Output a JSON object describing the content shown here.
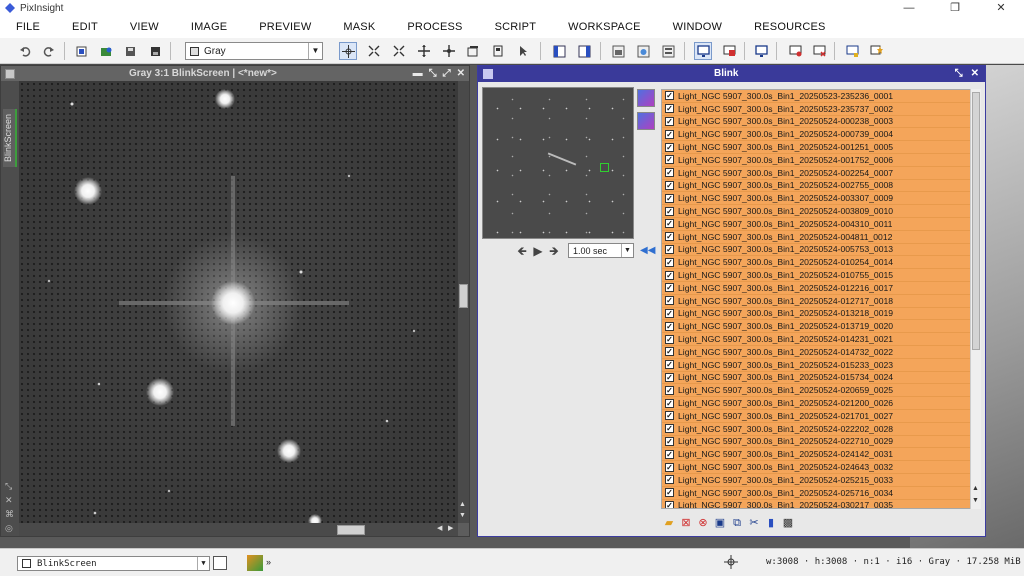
{
  "app": {
    "title": "PixInsight",
    "window_controls": [
      "—",
      "❐",
      "✕"
    ]
  },
  "menu": [
    "FILE",
    "EDIT",
    "VIEW",
    "IMAGE",
    "PREVIEW",
    "MASK",
    "PROCESS",
    "SCRIPT",
    "WORKSPACE",
    "WINDOW",
    "RESOURCES"
  ],
  "toolbar": {
    "mode_value": "Gray",
    "icons": [
      "undo-icon",
      "redo-icon",
      "new-image-icon",
      "open-icon",
      "save-icon",
      "save-as-icon",
      "close-image-icon"
    ]
  },
  "image_window": {
    "title": "Gray 3:1 BlinkScreen | <*new*>",
    "sidebar_tab": "BlinkScreen",
    "controls": [
      "▬",
      "⤡",
      "⤢",
      "✕"
    ]
  },
  "blink": {
    "title": "Blink",
    "controls": [
      "⤡",
      "✕"
    ],
    "interval": "1.00 sec",
    "files": [
      "Light_NGC 5907_300.0s_Bin1_20250523-235236_0001",
      "Light_NGC 5907_300.0s_Bin1_20250523-235737_0002",
      "Light_NGC 5907_300.0s_Bin1_20250524-000238_0003",
      "Light_NGC 5907_300.0s_Bin1_20250524-000739_0004",
      "Light_NGC 5907_300.0s_Bin1_20250524-001251_0005",
      "Light_NGC 5907_300.0s_Bin1_20250524-001752_0006",
      "Light_NGC 5907_300.0s_Bin1_20250524-002254_0007",
      "Light_NGC 5907_300.0s_Bin1_20250524-002755_0008",
      "Light_NGC 5907_300.0s_Bin1_20250524-003307_0009",
      "Light_NGC 5907_300.0s_Bin1_20250524-003809_0010",
      "Light_NGC 5907_300.0s_Bin1_20250524-004310_0011",
      "Light_NGC 5907_300.0s_Bin1_20250524-004811_0012",
      "Light_NGC 5907_300.0s_Bin1_20250524-005753_0013",
      "Light_NGC 5907_300.0s_Bin1_20250524-010254_0014",
      "Light_NGC 5907_300.0s_Bin1_20250524-010755_0015",
      "Light_NGC 5907_300.0s_Bin1_20250524-012216_0017",
      "Light_NGC 5907_300.0s_Bin1_20250524-012717_0018",
      "Light_NGC 5907_300.0s_Bin1_20250524-013218_0019",
      "Light_NGC 5907_300.0s_Bin1_20250524-013719_0020",
      "Light_NGC 5907_300.0s_Bin1_20250524-014231_0021",
      "Light_NGC 5907_300.0s_Bin1_20250524-014732_0022",
      "Light_NGC 5907_300.0s_Bin1_20250524-015233_0023",
      "Light_NGC 5907_300.0s_Bin1_20250524-015734_0024",
      "Light_NGC 5907_300.0s_Bin1_20250524-020659_0025",
      "Light_NGC 5907_300.0s_Bin1_20250524-021200_0026",
      "Light_NGC 5907_300.0s_Bin1_20250524-021701_0027",
      "Light_NGC 5907_300.0s_Bin1_20250524-022202_0028",
      "Light_NGC 5907_300.0s_Bin1_20250524-022710_0029",
      "Light_NGC 5907_300.0s_Bin1_20250524-024142_0031",
      "Light_NGC 5907_300.0s_Bin1_20250524-024643_0032",
      "Light_NGC 5907_300.0s_Bin1_20250524-025215_0033",
      "Light_NGC 5907_300.0s_Bin1_20250524-025716_0034",
      "Light_NGC 5907_300.0s_Bin1_20250524-030217_0035"
    ],
    "row_color": "#f4a55a"
  },
  "statusbar": {
    "view_value": "BlinkScreen",
    "info": "w:3008 · h:3008 · n:1 · i16 · Gray · 17.258 MiB"
  }
}
